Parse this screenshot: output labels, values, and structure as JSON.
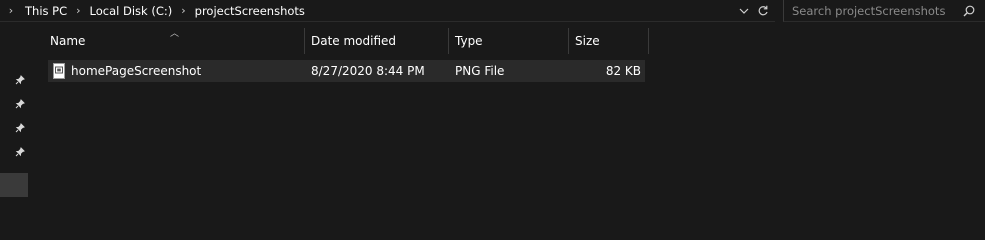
{
  "address": {
    "breadcrumbs": [
      "This PC",
      "Local Disk (C:)",
      "projectScreenshots"
    ]
  },
  "search": {
    "placeholder": "Search projectScreenshots"
  },
  "columns": {
    "name": "Name",
    "date_modified": "Date modified",
    "type": "Type",
    "size": "Size"
  },
  "files": [
    {
      "name": "homePageScreenshot",
      "date_modified": "8/27/2020 8:44 PM",
      "type": "PNG File",
      "size": "82 KB"
    }
  ],
  "icons": {
    "breadcrumb_separator": "chevron-right-icon",
    "address_dropdown": "chevron-down-icon",
    "refresh": "refresh-icon",
    "search": "search-icon",
    "pin": "pin-icon",
    "file": "png-file-icon"
  },
  "colors": {
    "background": "#191919",
    "selected_row": "#2a2a2a",
    "text": "#ffffff",
    "muted_text": "#8a8a8a"
  }
}
